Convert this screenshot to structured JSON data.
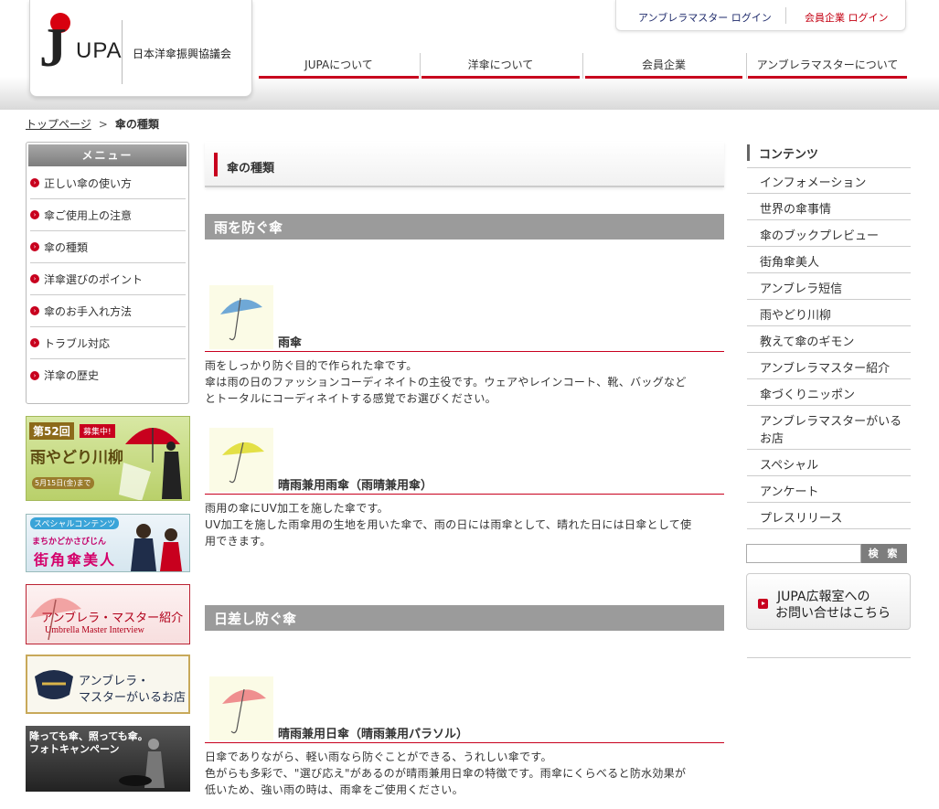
{
  "header": {
    "logo_text": "UPA",
    "logo_letter": "J",
    "org_name": "日本洋傘振興協議会",
    "login_master": "アンブレラマスター ログイン",
    "login_member": "会員企業 ログイン",
    "nav": [
      "JUPAについて",
      "洋傘について",
      "会員企業",
      "アンブレラマスターについて"
    ]
  },
  "breadcrumb": {
    "home": "トップページ",
    "sep": ">",
    "current": "傘の種類"
  },
  "menu": {
    "title": "メニュー",
    "items": [
      "正しい傘の使い方",
      "傘ご使用上の注意",
      "傘の種類",
      "洋傘選びのポイント",
      "傘のお手入れ方法",
      "トラブル対応",
      "洋傘の歴史"
    ]
  },
  "banners": {
    "senryu": {
      "title": "雨やどり川柳",
      "badge_no": "第52回",
      "badge_tag": "募集中!",
      "deadline": "5月15日(金)まで"
    },
    "bijin": {
      "tag": "スペシャルコンテンツ",
      "kana": "まちかどかさびじん",
      "title": "街角傘美人"
    },
    "master": {
      "title": "アンブレラ・マスター紹介",
      "subtitle": "Umbrella Master Interview"
    },
    "shop": {
      "line1": "アンブレラ・",
      "line2": "マスターがいるお店"
    },
    "photo": {
      "line1": "降っても傘、照っても傘。",
      "line2": "フォトキャンペーン"
    }
  },
  "main": {
    "title": "傘の種類",
    "sections": [
      {
        "heading": "雨を防ぐ傘",
        "items": [
          {
            "title": "雨傘",
            "desc": [
              "雨をしっかり防ぐ目的で作られた傘です。",
              "傘は雨の日のファッションコーディネイトの主役です。ウェアやレインコート、靴、バッグなど",
              "とトータルにコーディネイトする感覚でお選びください。"
            ]
          },
          {
            "title": "晴雨兼用雨傘（雨晴兼用傘）",
            "desc": [
              "雨用の傘にUV加工を施した傘です。",
              "UV加工を施した雨傘用の生地を用いた傘で、雨の日には雨傘として、晴れた日には日傘として使",
              "用できます。"
            ]
          }
        ]
      },
      {
        "heading": "日差し防ぐ傘",
        "items": [
          {
            "title": "晴雨兼用日傘（晴雨兼用パラソル）",
            "desc": [
              "日傘でありながら、軽い雨なら防ぐことができる、うれしい傘です。",
              "色がらも多彩で、\"選び応え\"があるのが晴雨兼用日傘の特徴です。雨傘にくらべると防水効果が",
              "低いため、強い雨の時は、雨傘をご使用ください。"
            ]
          }
        ]
      }
    ]
  },
  "sidebar": {
    "title": "コンテンツ",
    "items": [
      "インフォメーション",
      "世界の傘事情",
      "傘のブックプレビュー",
      "街角傘美人",
      "アンブレラ短信",
      "雨やどり川柳",
      "教えて傘のギモン",
      "アンブレラマスター紹介",
      "傘づくりニッポン",
      "アンブレラマスターがいる",
      "お店",
      "スペシャル",
      "アンケート",
      "プレスリリース"
    ],
    "search_button": "検 索",
    "pr_line1": "JUPA広報室への",
    "pr_line2": "お問い合せはこちら"
  },
  "colors": {
    "accent": "#c8001e",
    "umbrella_blue": "#6fa8d6",
    "umbrella_yellow": "#e3e046",
    "umbrella_pink": "#ef8f8f"
  }
}
